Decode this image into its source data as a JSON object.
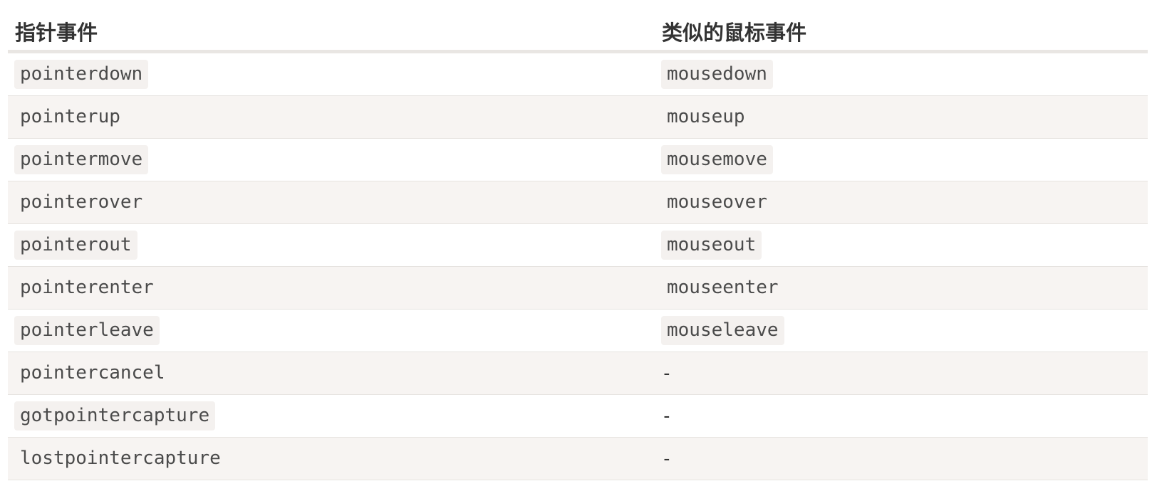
{
  "table": {
    "headers": [
      "指针事件",
      "类似的鼠标事件"
    ],
    "rows": [
      {
        "pointer": "pointerdown",
        "mouse": "mousedown"
      },
      {
        "pointer": "pointerup",
        "mouse": "mouseup"
      },
      {
        "pointer": "pointermove",
        "mouse": "mousemove"
      },
      {
        "pointer": "pointerover",
        "mouse": "mouseover"
      },
      {
        "pointer": "pointerout",
        "mouse": "mouseout"
      },
      {
        "pointer": "pointerenter",
        "mouse": "mouseenter"
      },
      {
        "pointer": "pointerleave",
        "mouse": "mouseleave"
      },
      {
        "pointer": "pointercancel",
        "mouse": "-"
      },
      {
        "pointer": "gotpointercapture",
        "mouse": "-"
      },
      {
        "pointer": "lostpointercapture",
        "mouse": "-"
      }
    ]
  }
}
